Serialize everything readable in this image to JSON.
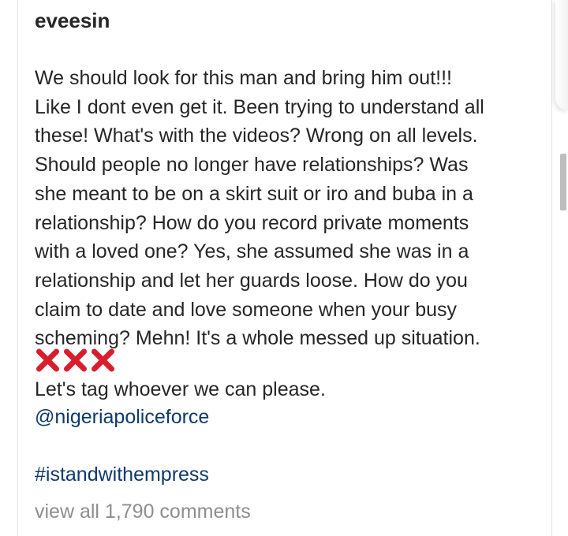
{
  "post": {
    "username": "eveesin",
    "caption_lines": [
      "We should look for this man and bring him out!!!",
      "Like I dont even get it. Been trying to understand all",
      "these! What's with the videos? Wrong on all levels.",
      "Should people no longer have relationships? Was",
      "she meant to be on a skirt suit or iro and buba in a",
      "relationship? How do you record private moments",
      "with a loved one? Yes, she assumed she was in a",
      "relationship and let her guards loose. How do you",
      "claim to date and love someone when your busy",
      "scheming? Mehn! It's a whole messed up situation."
    ],
    "emoji": {
      "icon": "cross-mark-icon",
      "count": 3,
      "color": "#d81e2c"
    },
    "tag_line": "Let's tag whoever we can please.",
    "mention": "@nigeriapoliceforce",
    "hashtag": "#istandwithempress",
    "view_comments": "view all 1,790 comments"
  },
  "colors": {
    "text": "#262626",
    "link": "#0f3a6b",
    "muted": "#8e8e8e",
    "cross": "#d81e2c"
  }
}
